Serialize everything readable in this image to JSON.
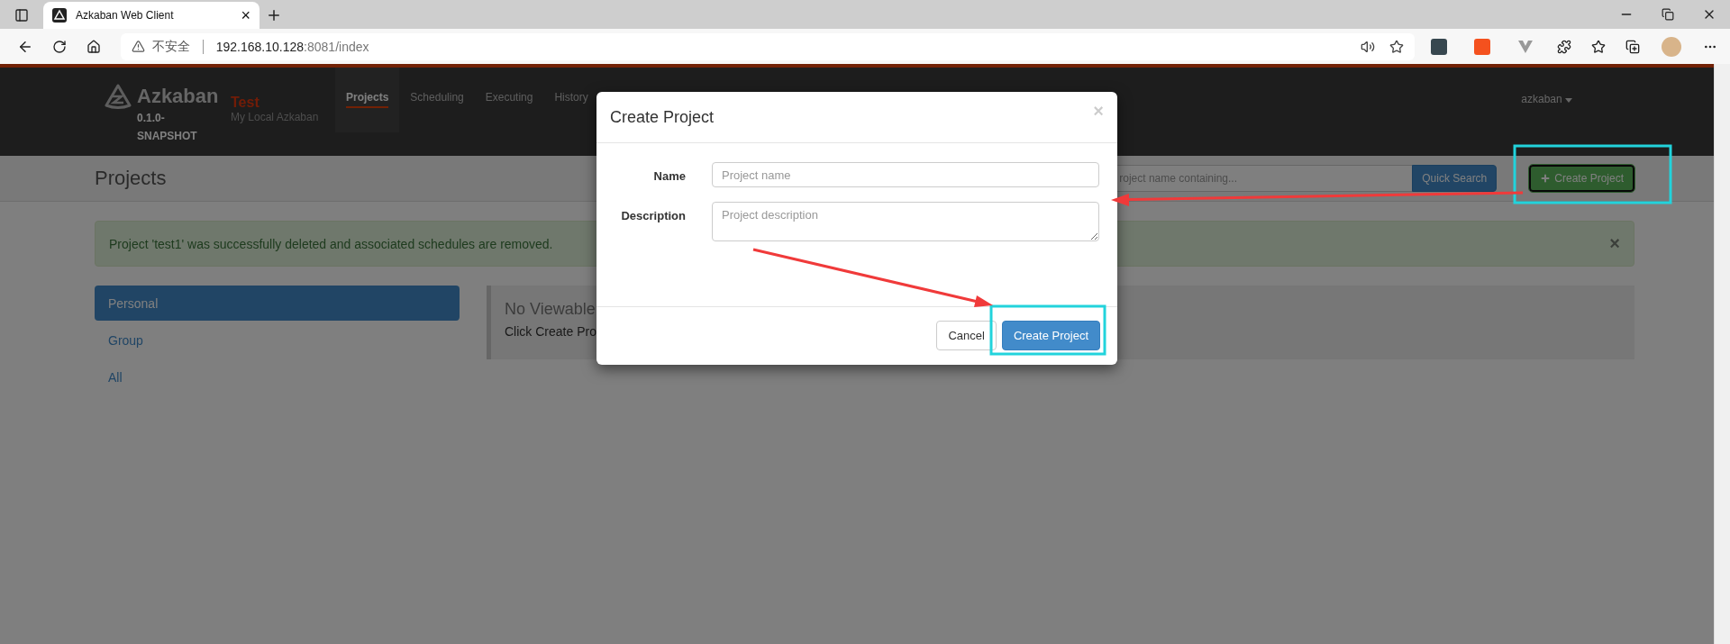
{
  "browser": {
    "tab_title": "Azkaban Web Client",
    "tab_close": "×",
    "security_label": "不安全",
    "url_host": "192.168.10.128",
    "url_rest": ":8081/index"
  },
  "navbar": {
    "brand": "Azkaban",
    "version": "0.1.0-SNAPSHOT",
    "env_name": "Test",
    "env_desc": "My Local Azkaban",
    "user": "azkaban",
    "menu": [
      {
        "label": "Projects",
        "selected": true
      },
      {
        "label": "Scheduling",
        "selected": false
      },
      {
        "label": "Executing",
        "selected": false
      },
      {
        "label": "History",
        "selected": false
      }
    ]
  },
  "header": {
    "title": "Projects",
    "search_placeholder": "roject name containing...",
    "search_button": "Quick Search",
    "create_button": "Create Project"
  },
  "alert": {
    "message": "Project 'test1' was successfully deleted and associated schedules are removed.",
    "close": "×"
  },
  "sidebar": [
    {
      "label": "Personal",
      "selected": true
    },
    {
      "label": "Group",
      "selected": false
    },
    {
      "label": "All",
      "selected": false
    }
  ],
  "panel": {
    "title": "No Viewable",
    "hint": "Click Create Pro"
  },
  "modal": {
    "title": "Create Project",
    "close": "×",
    "fields": [
      {
        "kind": "input",
        "label": "Name",
        "placeholder": "Project name"
      },
      {
        "kind": "textarea",
        "label": "Description",
        "placeholder": "Project description"
      }
    ],
    "buttons": [
      {
        "kind": "default",
        "label": "Cancel"
      },
      {
        "kind": "primary",
        "label": "Create Project"
      }
    ]
  }
}
